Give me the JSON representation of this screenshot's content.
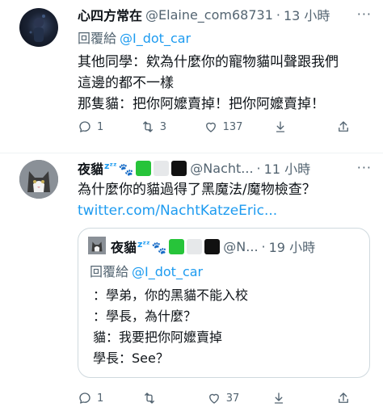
{
  "tweet1": {
    "display_name": "心四方常在",
    "handle": "@Elaine_com68731",
    "separator": "·",
    "time": "13 小時",
    "more_label": "···",
    "reply_prefix": "回覆給",
    "reply_mention": "@I_dot_car",
    "body_lines": [
      "其他同學：欸為什麼你的寵物貓叫聲跟我們",
      "這邊的都不一樣",
      "那隻貓：把你阿嬤賣掉！把你阿嬤賣掉！"
    ],
    "actions": {
      "reply_count": "1",
      "retweet_count": "3",
      "like_count": "137",
      "views_count": "",
      "share_count": ""
    }
  },
  "tweet2": {
    "display_name": "夜貓",
    "zzz": "zᶻᶻ",
    "paws": "🐾",
    "handle": "@Nacht...",
    "separator": "·",
    "time": "11 小時",
    "more_label": "···",
    "body_lines": [
      "為什麼你的貓過得了黑魔法/魔物檢查？"
    ],
    "link_text": "twitter.com/NachtKatzeEric...",
    "quote": {
      "display_name": "夜貓",
      "zzz": "zᶻᶻ",
      "paws": "🐾",
      "handle": "@N...",
      "separator": "·",
      "time": "19 小時",
      "reply_prefix": "回覆給",
      "reply_mention": "@I_dot_car",
      "body_lines": [
        "：學弟，你的黑貓不能入校",
        "：學長，為什麼？",
        "貓：我要把你阿嬤賣掉",
        "學長：See？"
      ]
    },
    "actions": {
      "reply_count": "1",
      "retweet_count": "",
      "like_count": "37",
      "views_count": "",
      "share_count": ""
    }
  },
  "colors": {
    "accent": "#1d9bf0",
    "secondary_text": "#536471",
    "border": "#cfd9de",
    "green_square": "#27c43a"
  }
}
